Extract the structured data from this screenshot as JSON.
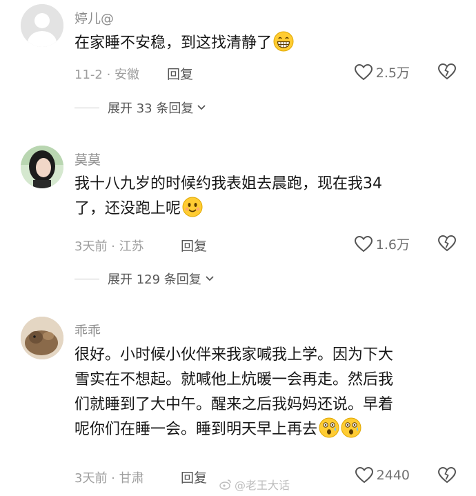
{
  "comments": [
    {
      "username": "婷儿@",
      "text": "在家睡不安稳，到这找清静了",
      "emoji": [
        "grin-emoji"
      ],
      "meta": "11-2 · 安徽",
      "reply_label": "回复",
      "likes": "2.5万",
      "expand_label": "展开 33 条回复"
    },
    {
      "username": "莫莫",
      "text_lines": [
        "我十八九岁的时候约我表姐去晨跑，现在我34",
        "了，还没跑上呢"
      ],
      "emoji": [
        "smile-emoji"
      ],
      "meta": "3天前 · 江苏",
      "reply_label": "回复",
      "likes": "1.6万",
      "expand_label": "展开 129 条回复"
    },
    {
      "username": "乖乖",
      "text_lines": [
        "很好。小时候小伙伴来我家喊我上学。因为下大",
        "雪实在不想起。就喊他上炕暖一会再走。然后我",
        "们就睡到了大中午。醒来之后我妈妈还说。早着",
        "呢你们在睡一会。睡到明天早上再去"
      ],
      "emoji": [
        "astonished-emoji",
        "astonished-emoji"
      ],
      "meta": "3天前 · 甘肃",
      "reply_label": "回复",
      "likes": "2440"
    }
  ],
  "watermark": "@老王大话",
  "colors": {
    "text": "#161616",
    "muted": "#9e9e9e",
    "emoji_yellow": "#ffcc33"
  }
}
